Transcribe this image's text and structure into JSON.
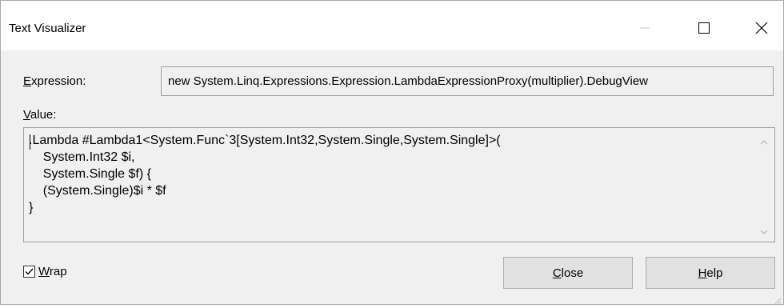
{
  "window": {
    "title": "Text Visualizer",
    "minimize_icon": "minimize-icon",
    "maximize_icon": "maximize-icon",
    "close_icon": "close-icon"
  },
  "expression": {
    "label_prefix": "E",
    "label_rest": "xpression:",
    "value": "new System.Linq.Expressions.Expression.LambdaExpressionProxy(multiplier).DebugView"
  },
  "value": {
    "label_prefix": "V",
    "label_rest": "alue:",
    "text": ".Lambda #Lambda1<System.Func`3[System.Int32,System.Single,System.Single]>(\n    System.Int32 $i,\n    System.Single $f) {\n    (System.Single)$i * $f\n}"
  },
  "wrap": {
    "checked": true,
    "label_prefix": "W",
    "label_rest": "rap"
  },
  "buttons": {
    "close_prefix": "C",
    "close_rest": "lose",
    "help_prefix": "H",
    "help_rest": "elp"
  }
}
